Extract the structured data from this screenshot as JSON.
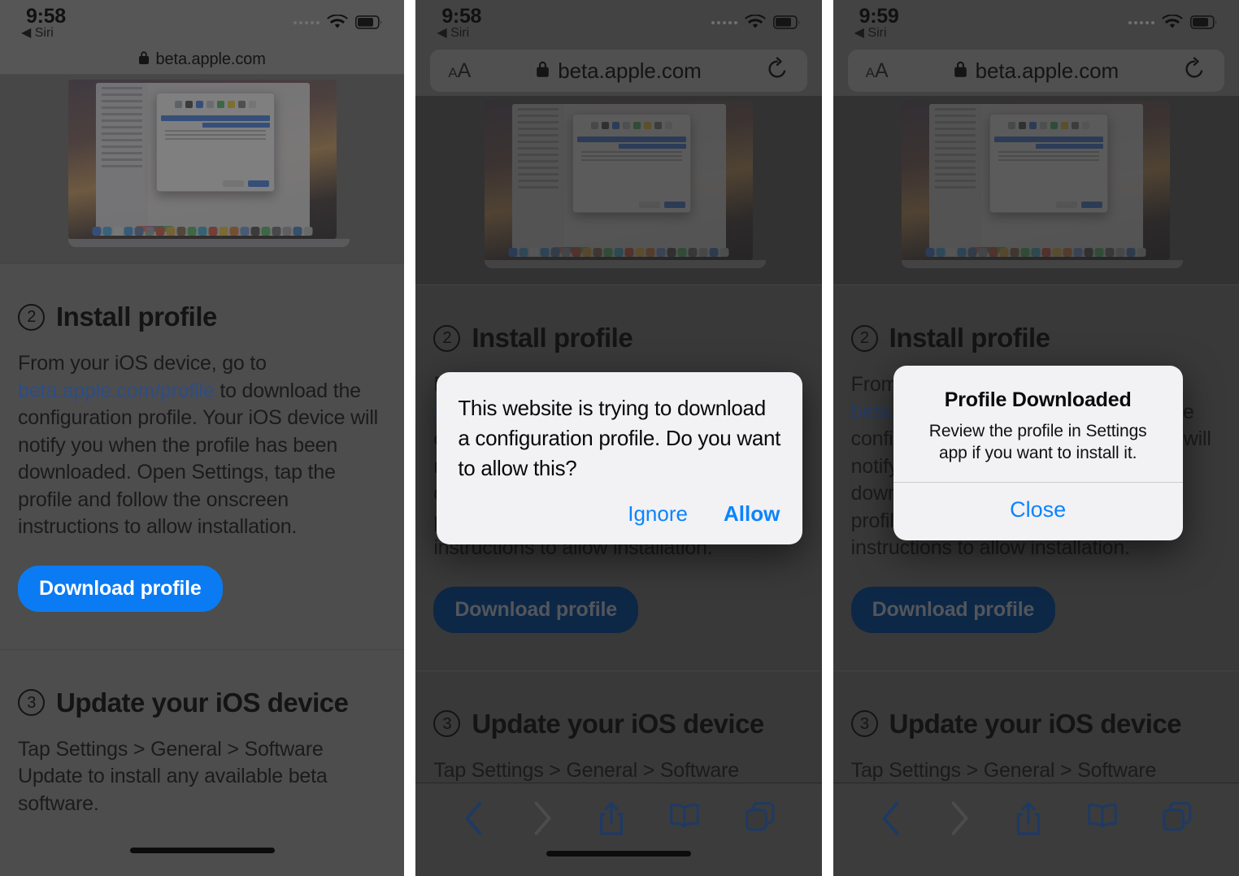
{
  "panels": [
    {
      "id": "panel-1",
      "status": {
        "time": "9:58",
        "back_label": "◀ Siri"
      },
      "url": "beta.apple.com",
      "lock_icon": "lock-icon",
      "wifi_icon": "wifi-icon",
      "battery_icon": "battery-icon"
    },
    {
      "id": "panel-2",
      "status": {
        "time": "9:58",
        "back_label": "◀ Siri"
      },
      "url": "beta.apple.com",
      "text_size_label": "A",
      "text_size_label_big": "A",
      "reload_icon": "reload-icon"
    },
    {
      "id": "panel-3",
      "status": {
        "time": "9:59",
        "back_label": "◀ Siri"
      },
      "url": "beta.apple.com",
      "text_size_label": "A",
      "text_size_label_big": "A",
      "reload_icon": "reload-icon"
    }
  ],
  "page": {
    "step2": {
      "number": "2",
      "heading": "Install profile",
      "body_before_link": "From your iOS device, go to ",
      "link": "beta.apple.com/profile",
      "body_after_link": " to download the configuration profile. Your iOS device will notify you when the profile has been downloaded. Open Settings, tap the profile and follow the onscreen instructions to allow installation.",
      "button": "Download profile"
    },
    "step3": {
      "number": "3",
      "heading": "Update your iOS device",
      "body": "Tap Settings > General > Software Update to install any available beta software."
    }
  },
  "alert_download": {
    "message": "This website is trying to download a configuration profile. Do you want to allow this?",
    "ignore": "Ignore",
    "allow": "Allow"
  },
  "alert_downloaded": {
    "title": "Profile Downloaded",
    "subtitle": "Review the profile in Settings app if you want to install it.",
    "close": "Close"
  },
  "toolbar": {
    "back_icon": "back-chevron-icon",
    "forward_icon": "forward-chevron-icon",
    "share_icon": "share-icon",
    "bookmarks_icon": "book-icon",
    "tabs_icon": "tabs-icon"
  },
  "colors": {
    "accent_blue": "#0b7bf4",
    "alert_blue": "#0a84ff",
    "link_blue": "#2d4d86",
    "toolbar_icon": "#1e3a63"
  }
}
